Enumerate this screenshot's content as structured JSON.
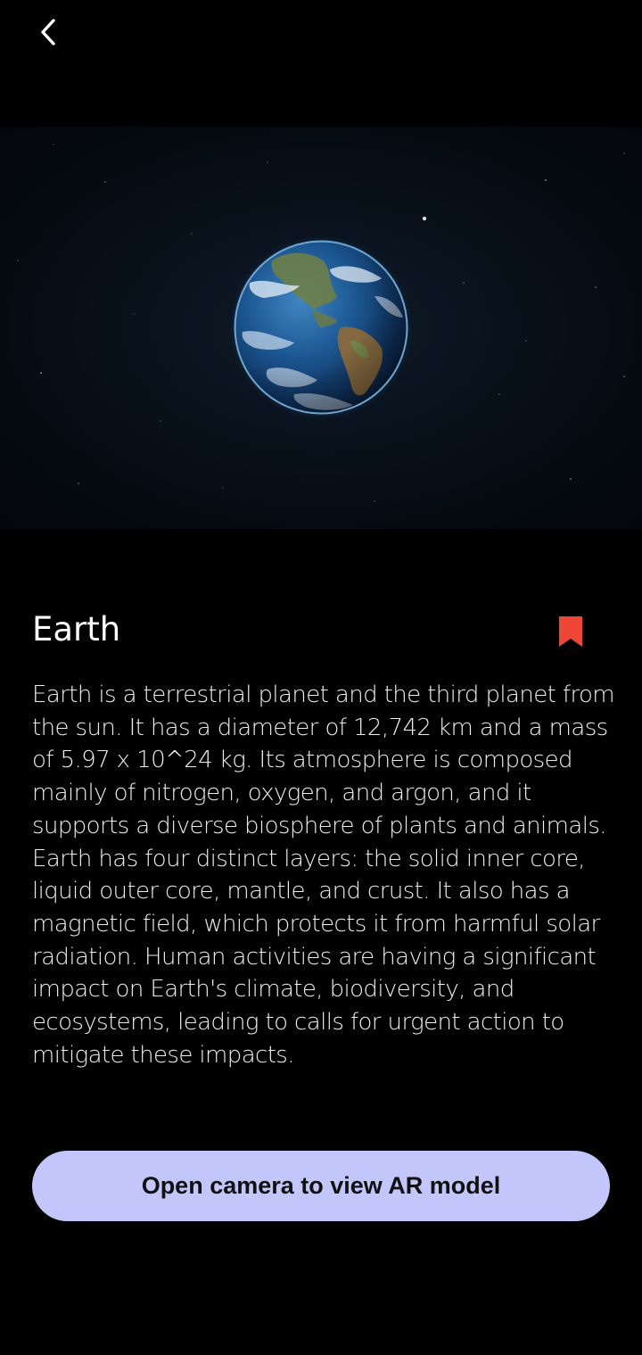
{
  "header": {
    "back_icon": "chevron-left-icon"
  },
  "hero": {
    "image": "earth-planet-in-space"
  },
  "planet": {
    "name": "Earth",
    "bookmark_icon": "bookmark-icon",
    "bookmark_color": "#ef4638",
    "description": "Earth is a terrestrial planet and the third planet from the sun. It has a diameter of 12,742 km and a mass of 5.97 x 10^24 kg. Its atmosphere is composed mainly of nitrogen, oxygen, and argon, and it supports a diverse biosphere of plants and animals. Earth has four distinct layers: the solid inner core, liquid outer core, mantle, and crust. It also has a magnetic field, which protects it from harmful solar radiation. Human activities are having a significant impact on Earth's climate, biodiversity, and ecosystems, leading to calls for urgent action to mitigate these impacts."
  },
  "actions": {
    "ar_button_label": "Open camera to view AR model",
    "ar_button_color": "#c3c6fb"
  }
}
